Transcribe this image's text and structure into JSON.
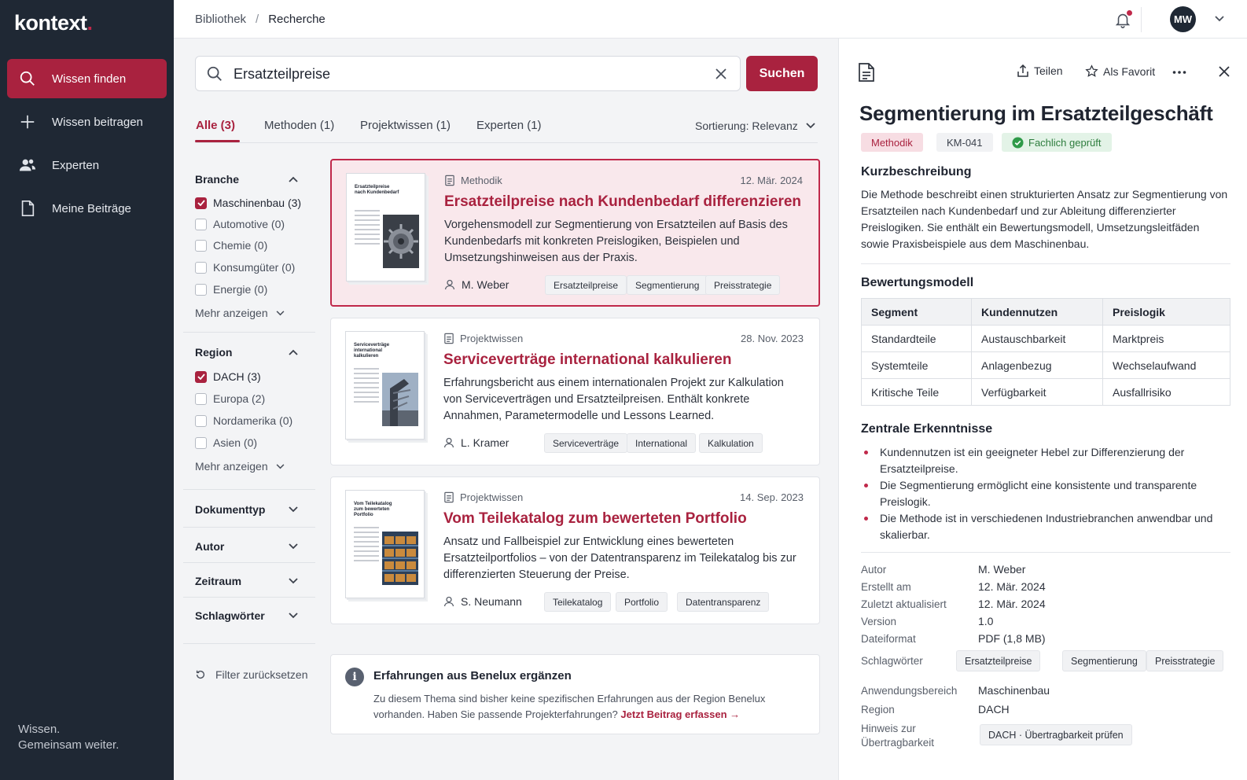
{
  "app": {
    "logo": "kontext",
    "logo_dot": ".",
    "tagline_1": "Wissen.",
    "tagline_2": "Gemeinsam weiter."
  },
  "sidebar": {
    "items": [
      {
        "label": "Wissen finden",
        "icon": "search-icon",
        "active": true
      },
      {
        "label": "Wissen beitragen",
        "icon": "plus-icon"
      },
      {
        "label": "Experten",
        "icon": "users-icon"
      },
      {
        "label": "Meine Beiträge",
        "icon": "document-icon"
      }
    ]
  },
  "topbar": {
    "breadcrumb": [
      "Bibliothek",
      "Recherche"
    ],
    "avatar_initials": "MW"
  },
  "search": {
    "value": "Ersatzteilpreise",
    "button": "Suchen"
  },
  "tabs": [
    "Alle (3)",
    "Methoden (1)",
    "Projektwissen (1)",
    "Experten (1)"
  ],
  "sort_label": "Sortierung: Relevanz",
  "filters": {
    "branche": {
      "title": "Branche",
      "items": [
        "Maschinenbau (3)",
        "Automotive (0)",
        "Chemie (0)",
        "Konsumgüter (0)",
        "Energie (0)"
      ],
      "more": "Mehr anzeigen"
    },
    "region": {
      "title": "Region",
      "items": [
        "DACH (3)",
        "Europa (2)",
        "Nordamerika (0)",
        "Asien (0)"
      ],
      "more": "Mehr anzeigen"
    },
    "collapsed": [
      "Dokumenttyp",
      "Autor",
      "Zeitraum",
      "Schlagwörter"
    ],
    "reset": "Filter zurücksetzen"
  },
  "results": [
    {
      "type": "Methodik",
      "date": "12. Mär. 2024",
      "title": "Ersatzteilpreise nach Kundenbedarf differenzieren",
      "desc": "Vorgehensmodell zur Segmentierung von Ersatzteilen auf Basis des Kundenbedarfs mit konkreten Preislogiken, Beispielen und Umsetzungshinweisen aus der Praxis.",
      "author": "M. Weber",
      "tags": [
        "Ersatzteilpreise",
        "Segmentierung",
        "Preisstrategie"
      ],
      "thumb_title": "Ersatzteilpreise nach Kundenbedarf"
    },
    {
      "type": "Projektwissen",
      "date": "28. Nov. 2023",
      "title": "Serviceverträge international kalkulieren",
      "desc": "Erfahrungsbericht aus einem internationalen Projekt zur Kalkulation von Serviceverträgen und Ersatzteilpreisen. Enthält konkrete Annahmen, Parametermodelle und Lessons Learned.",
      "author": "L. Kramer",
      "tags": [
        "Serviceverträge",
        "International",
        "Kalkulation"
      ],
      "thumb_title": "Serviceverträge international kalkulieren"
    },
    {
      "type": "Projektwissen",
      "date": "14. Sep. 2023",
      "title": "Vom Teilekatalog zum bewerteten Portfolio",
      "desc": "Ansatz und Fallbeispiel zur Entwicklung eines bewerteten Ersatzteilportfolios – von der Datentransparenz im Teilekatalog bis zur differenzierten Steuerung der Preise.",
      "author": "S. Neumann",
      "tags": [
        "Teilekatalog",
        "Portfolio",
        "Datentransparenz"
      ],
      "thumb_title": "Vom Teilekatalog zum bewerteten Portfolio"
    }
  ],
  "info": {
    "title": "Erfahrungen aus Benelux ergänzen",
    "text": "Zu diesem Thema sind bisher keine spezifischen Erfahrungen aus der Region Benelux vorhanden. Haben Sie passende Projekterfahrungen?",
    "link": "Jetzt Beitrag erfassen →"
  },
  "detail": {
    "actions": {
      "share": "Teilen",
      "favorite": "Als Favorit"
    },
    "title": "Segmentierung im Ersatzteilgeschäft",
    "badges": {
      "type": "Methodik",
      "id": "KM-041",
      "status": "Fachlich geprüft"
    },
    "summary_title": "Kurzbeschreibung",
    "summary": "Die Methode beschreibt einen strukturierten Ansatz zur Segmentierung von Ersatzteilen nach Kundenbedarf und zur Ableitung differenzierter Preislogiken. Sie enthält ein Bewertungsmodell, Umsetzungsleitfäden sowie Praxisbeispiele aus dem Maschinenbau.",
    "model_title": "Bewertungsmodell",
    "model_headers": [
      "Segment",
      "Kundennutzen",
      "Preislogik"
    ],
    "model_rows": [
      [
        "Standardteile",
        "Austauschbarkeit",
        "Marktpreis"
      ],
      [
        "Systemteile",
        "Anlagenbezug",
        "Wechselaufwand"
      ],
      [
        "Kritische Teile",
        "Verfügbarkeit",
        "Ausfallrisiko"
      ]
    ],
    "insights_title": "Zentrale Erkenntnisse",
    "insights": [
      "Kundennutzen ist ein geeigneter Hebel zur Differenzierung der Ersatzteilpreise.",
      "Die Segmentierung ermöglicht eine konsistente und transparente Preislogik.",
      "Die Methode ist in verschiedenen Industriebranchen anwendbar und skalierbar."
    ],
    "meta": {
      "author_k": "Autor",
      "author_v": "M. Weber",
      "created_k": "Erstellt am",
      "created_v": "12. Mär. 2024",
      "updated_k": "Zuletzt aktualisiert",
      "updated_v": "12. Mär. 2024",
      "version_k": "Version",
      "version_v": "1.0",
      "format_k": "Dateiformat",
      "format_v": "PDF (1,8 MB)",
      "tags_k": "Schlagwörter",
      "tags": [
        "Ersatzteilpreise",
        "Segmentierung",
        "Preisstrategie"
      ],
      "area_k": "Anwendungsbereich",
      "area_v": "Maschinenbau",
      "region_k": "Region",
      "region_v": "DACH",
      "hint_k": "Hinweis zur Übertragbarkeit",
      "hint_v": "DACH · Übertragbarkeit prüfen"
    }
  },
  "colors": {
    "accent": "#a9223f",
    "sidebar": "#1f2834",
    "success": "#2e7d3e"
  }
}
